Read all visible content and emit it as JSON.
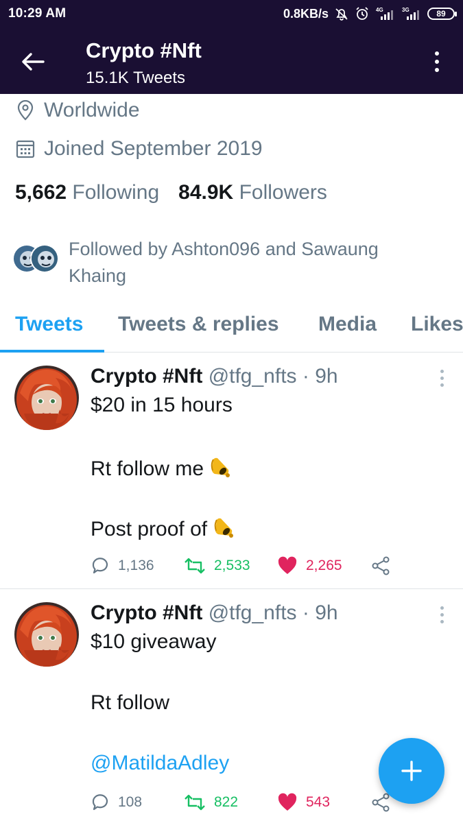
{
  "status_bar": {
    "time": "10:29 AM",
    "net_speed": "0.8KB/s",
    "network_1": "4G",
    "network_2": "3G",
    "battery": "89",
    "icons": [
      "mute-bell-icon",
      "alarm-icon",
      "signal-4g-icon",
      "signal-3g-icon",
      "battery-icon"
    ]
  },
  "header": {
    "title": "Crypto #Nft",
    "subtitle": "15.1K Tweets",
    "background": "#1a0f33"
  },
  "profile": {
    "location": "Worldwide",
    "joined": "Joined September 2019",
    "following_count": "5,662",
    "following_label": "Following",
    "followers_count": "84.9K",
    "followers_label": "Followers",
    "followed_by": "Followed by Ashton096 and Sawaung Khaing"
  },
  "tabs": [
    {
      "label": "Tweets",
      "active": true
    },
    {
      "label": "Tweets & replies",
      "active": false
    },
    {
      "label": "Media",
      "active": false
    },
    {
      "label": "Likes",
      "active": false
    }
  ],
  "tweets": [
    {
      "name": "Crypto #Nft",
      "handle": "@tfg_nfts · 9h",
      "lines": [
        "$20 in 15 hours",
        "Rt follow me",
        "Post proof of"
      ],
      "replies": "1,136",
      "retweets": "2,533",
      "likes": "2,265"
    },
    {
      "name": "Crypto #Nft",
      "handle": "@tfg_nfts · 9h",
      "lines": [
        "$10 giveaway",
        "Rt follow",
        "@MatildaAdley"
      ],
      "replies": "108",
      "retweets": "822",
      "likes": "543"
    }
  ],
  "colors": {
    "accent": "#1da1f2",
    "retweet": "#17bf63",
    "like": "#e0245e",
    "muted": "#657786"
  }
}
